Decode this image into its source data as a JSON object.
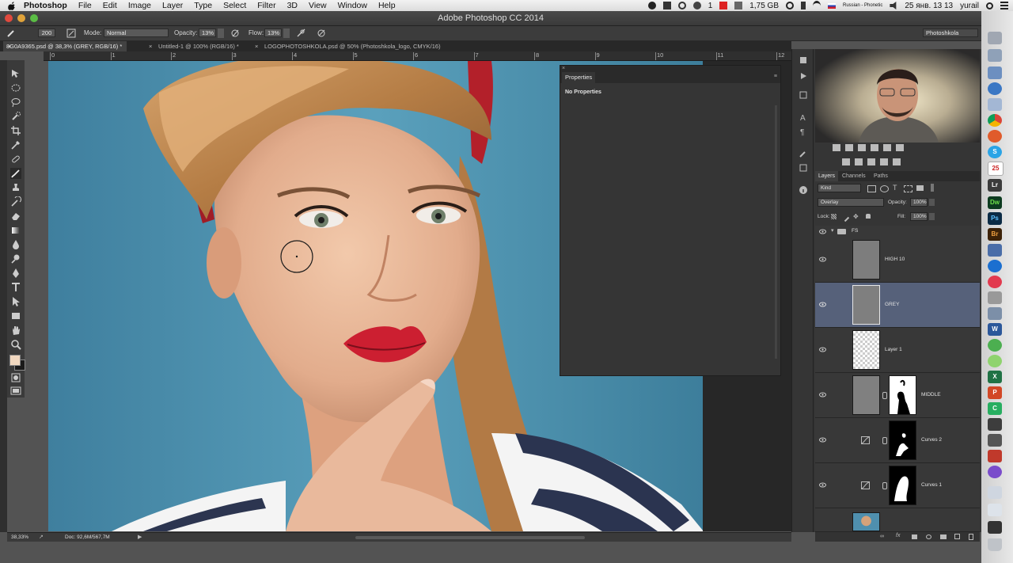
{
  "menubar": {
    "app_name": "Photoshop",
    "items": [
      "File",
      "Edit",
      "Image",
      "Layer",
      "Type",
      "Select",
      "Filter",
      "3D",
      "View",
      "Window",
      "Help"
    ],
    "status": {
      "indicator": "1",
      "memory": "1,75 GB",
      "keyboard": "Russian - Phonetic",
      "date_time": "25 янв. 13 13",
      "user": "yurail"
    }
  },
  "window": {
    "title": "Adobe Photoshop CC 2014"
  },
  "options_bar": {
    "brush_size": "200",
    "mode_label": "Mode:",
    "mode_value": "Normal",
    "opacity_label": "Opacity:",
    "opacity_value": "13%",
    "flow_label": "Flow:",
    "flow_value": "13%",
    "workspace": "Photoshkola"
  },
  "doc_tabs": [
    {
      "label": "8G0A9365.psd @ 38,3% (GREY, RGB/16) *",
      "active": true
    },
    {
      "label": "Untitled-1 @ 100% (RGB/16) *",
      "active": false
    },
    {
      "label": "LOGOPHOTOSHKOLA.psd @ 50% (Photoshkola_logo, CMYK/16)",
      "active": false
    }
  ],
  "ruler": {
    "marks": [
      "0",
      "1",
      "2",
      "3",
      "4",
      "5",
      "6",
      "7",
      "8",
      "9",
      "10",
      "11",
      "12"
    ]
  },
  "properties_panel": {
    "tab": "Properties",
    "message": "No Properties"
  },
  "layers_panel": {
    "tabs": [
      "Layers",
      "Channels",
      "Paths"
    ],
    "filter_kind": "Kind",
    "blend_mode": "Overlay",
    "opacity_label": "Opacity:",
    "opacity_value": "100%",
    "lock_label": "Lock:",
    "fill_label": "Fill:",
    "fill_value": "100%",
    "group_name": "FS",
    "layers": [
      {
        "name": "HIGH 10",
        "thumb": "gray",
        "selected": false
      },
      {
        "name": "GREY",
        "thumb": "gray",
        "selected": true
      },
      {
        "name": "Layer 1",
        "thumb": "transparent",
        "selected": false
      },
      {
        "name": "MIDDLE",
        "thumb": "gray-mask",
        "selected": false
      },
      {
        "name": "Curves 2",
        "thumb": "curves-mask",
        "selected": false
      },
      {
        "name": "Curves 1",
        "thumb": "curves-mask",
        "selected": false
      }
    ]
  },
  "status_bar": {
    "zoom": "38,33%",
    "doc_size": "Doc: 92,6M/567,7M"
  },
  "dock_apps": [
    "Dw",
    "Ps",
    "Br",
    "S",
    "W",
    "X",
    "P",
    "C"
  ],
  "colors": {
    "foreground": "#f1d8c0",
    "background": "#1a1a1a",
    "selected_layer": "#56617a"
  }
}
